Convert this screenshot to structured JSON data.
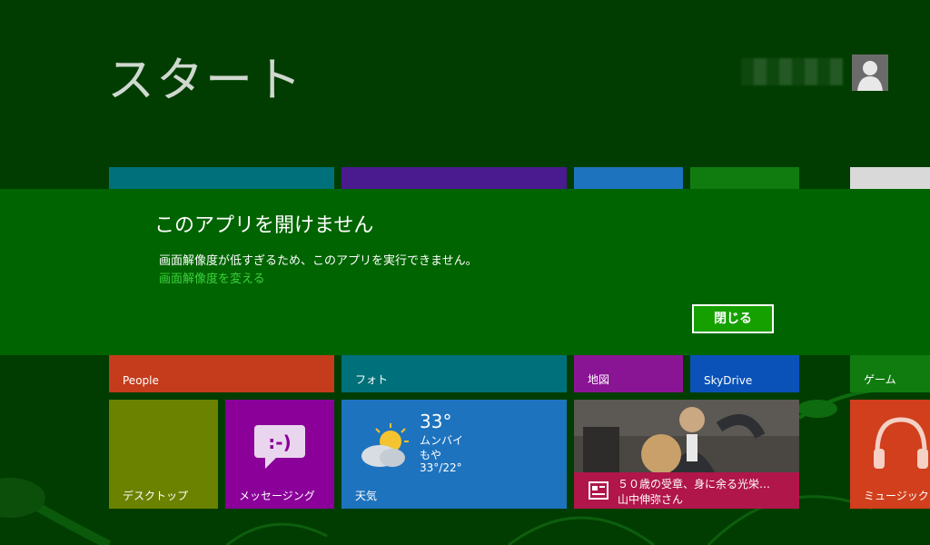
{
  "start": {
    "title": "スタート"
  },
  "user": {
    "avatar_icon": "user-icon"
  },
  "tiles": {
    "people": {
      "label": "People",
      "color": "#c43c1c"
    },
    "photos": {
      "label": "フォト",
      "color": "#00717a"
    },
    "maps": {
      "label": "地図",
      "color": "#8a1594"
    },
    "skydrive": {
      "label": "SkyDrive",
      "color": "#0a52b8"
    },
    "games": {
      "label": "ゲーム",
      "color": "#107c10"
    },
    "desktop": {
      "label": "デスクトップ",
      "color": "#6b8200"
    },
    "messaging": {
      "label": "メッセージング",
      "color": "#8a0099",
      "icon": "chat-smiley-icon"
    },
    "weather": {
      "label": "天気",
      "color": "#1e73be",
      "temperature": "33°",
      "location": "ムンバイ",
      "condition": "もや",
      "range": "33°/22°",
      "icon": "cloud-sun-icon"
    },
    "news": {
      "headline": "５０歳の受章、身に余る光栄…",
      "author": "山中伸弥さん",
      "icon": "news-icon",
      "caption_color": "#b0164a"
    },
    "music": {
      "label": "ミュージック",
      "color": "#d13f1c",
      "icon": "headphones-icon"
    }
  },
  "dialog": {
    "title": "このアプリを開けません",
    "message": "画面解像度が低すぎるため、このアプリを実行できません。",
    "link": "画面解像度を変える",
    "close_button": "閉じる",
    "background": "#006400",
    "link_color": "#3dd13d"
  }
}
